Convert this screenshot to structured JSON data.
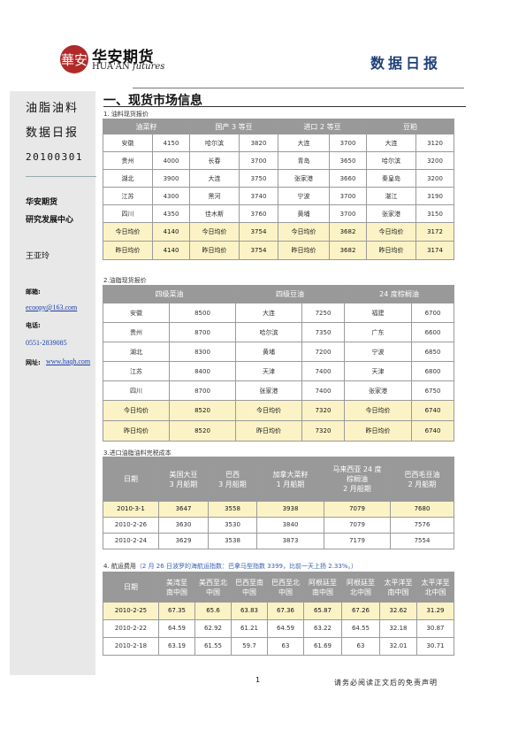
{
  "header": {
    "logo_seal": "華安",
    "logo_cn": "华安期货",
    "logo_en_main": "HUA'AN",
    "logo_en_italic": "futures",
    "report_title": "数据日报"
  },
  "sidebar": {
    "topic_line1": "油脂油料",
    "topic_line2": "数据日报",
    "date": "20100301",
    "company": "华安期货",
    "dept": "研究发展中心",
    "author": "王亚玲",
    "email_label": "邮箱:",
    "email": "ecoopy@163.com",
    "phone_label": "电话:",
    "phone": "0551-2839085",
    "web_label": "网址:",
    "web": "www.haqh.com"
  },
  "section": {
    "title": "一、现货市场信息"
  },
  "t1": {
    "title": "1. 油料现货报价",
    "headers": [
      "油菜籽",
      "国产 3 等豆",
      "进口 2 等豆",
      "豆粕"
    ],
    "rows": [
      [
        "安徽",
        "4150",
        "哈尔滨",
        "3820",
        "大连",
        "3700",
        "大连",
        "3120"
      ],
      [
        "贵州",
        "4000",
        "长春",
        "3700",
        "青岛",
        "3650",
        "哈尔滨",
        "3200"
      ],
      [
        "湖北",
        "3900",
        "大连",
        "3750",
        "张家港",
        "3660",
        "秦皇岛",
        "3200"
      ],
      [
        "江苏",
        "4300",
        "黑河",
        "3740",
        "宁波",
        "3700",
        "湛江",
        "3190"
      ],
      [
        "四川",
        "4350",
        "佳木斯",
        "3760",
        "黄埔",
        "3700",
        "张家港",
        "3150"
      ]
    ],
    "avg_rows": [
      [
        "今日均价",
        "4140",
        "今日均价",
        "3754",
        "今日均价",
        "3682",
        "今日均价",
        "3172"
      ],
      [
        "昨日均价",
        "4140",
        "昨日均价",
        "3754",
        "昨日均价",
        "3682",
        "昨日均价",
        "3174"
      ]
    ]
  },
  "t2": {
    "title": "2.油脂现货报价",
    "headers": [
      "四级菜油",
      "四级豆油",
      "24 度棕榈油"
    ],
    "rows": [
      [
        "安徽",
        "8500",
        "大连",
        "7250",
        "福建",
        "6700"
      ],
      [
        "贵州",
        "8700",
        "哈尔滨",
        "7350",
        "广东",
        "6600"
      ],
      [
        "湖北",
        "8300",
        "黄埔",
        "7200",
        "宁波",
        "6850"
      ],
      [
        "江苏",
        "8400",
        "天津",
        "7400",
        "天津",
        "6800"
      ],
      [
        "四川",
        "8700",
        "张家港",
        "7400",
        "张家港",
        "6750"
      ]
    ],
    "avg_rows": [
      [
        "今日均价",
        "8520",
        "今日均价",
        "7320",
        "今日均价",
        "6740"
      ],
      [
        "昨日均价",
        "8520",
        "昨日均价",
        "7320",
        "昨日均价",
        "6740"
      ]
    ]
  },
  "t3": {
    "title": "3.进口油脂油料完税成本",
    "headers": [
      [
        "日期"
      ],
      [
        "美国大豆",
        "3 月船期"
      ],
      [
        "巴西",
        "3 月船期"
      ],
      [
        "加拿大菜籽",
        "1 月船期"
      ],
      [
        "马来西亚 24 度",
        "棕榈油",
        "2 月船期"
      ],
      [
        "巴西毛豆油",
        "2 月船期"
      ]
    ],
    "rows": [
      [
        "2010-3-1",
        "3647",
        "3558",
        "3938",
        "7079",
        "7680"
      ],
      [
        "2010-2-26",
        "3630",
        "3530",
        "3840",
        "7079",
        "7576"
      ],
      [
        "2010-2-24",
        "3629",
        "3538",
        "3873",
        "7179",
        "7554"
      ]
    ]
  },
  "t4": {
    "title": "4. 航运费用",
    "note": "（2 月 26 日波罗的海航运指数：巴拿马型指数 3399，比前一天上扬 2.33%。）",
    "headers": [
      [
        "日期"
      ],
      [
        "美湾至",
        "南中国"
      ],
      [
        "美西至北",
        "中国"
      ],
      [
        "巴西至南",
        "中国"
      ],
      [
        "巴西至北",
        "中国"
      ],
      [
        "阿根廷至",
        "南中国"
      ],
      [
        "阿根廷至",
        "北中国"
      ],
      [
        "太平洋至",
        "南中国"
      ],
      [
        "太平洋至",
        "北中国"
      ]
    ],
    "rows": [
      [
        "2010-2-25",
        "67.35",
        "65.6",
        "63.83",
        "67.36",
        "65.87",
        "67.26",
        "32.62",
        "31.29"
      ],
      [
        "2010-2-22",
        "64.59",
        "62.92",
        "61.21",
        "64.59",
        "63.22",
        "64.55",
        "32.18",
        "30.87"
      ],
      [
        "2010-2-18",
        "63.19",
        "61.55",
        "59.7",
        "63",
        "61.69",
        "63",
        "32.01",
        "30.71"
      ]
    ]
  },
  "footer": {
    "page_number": "1",
    "disclaimer": "请务必阅读正文后的免责声明"
  }
}
